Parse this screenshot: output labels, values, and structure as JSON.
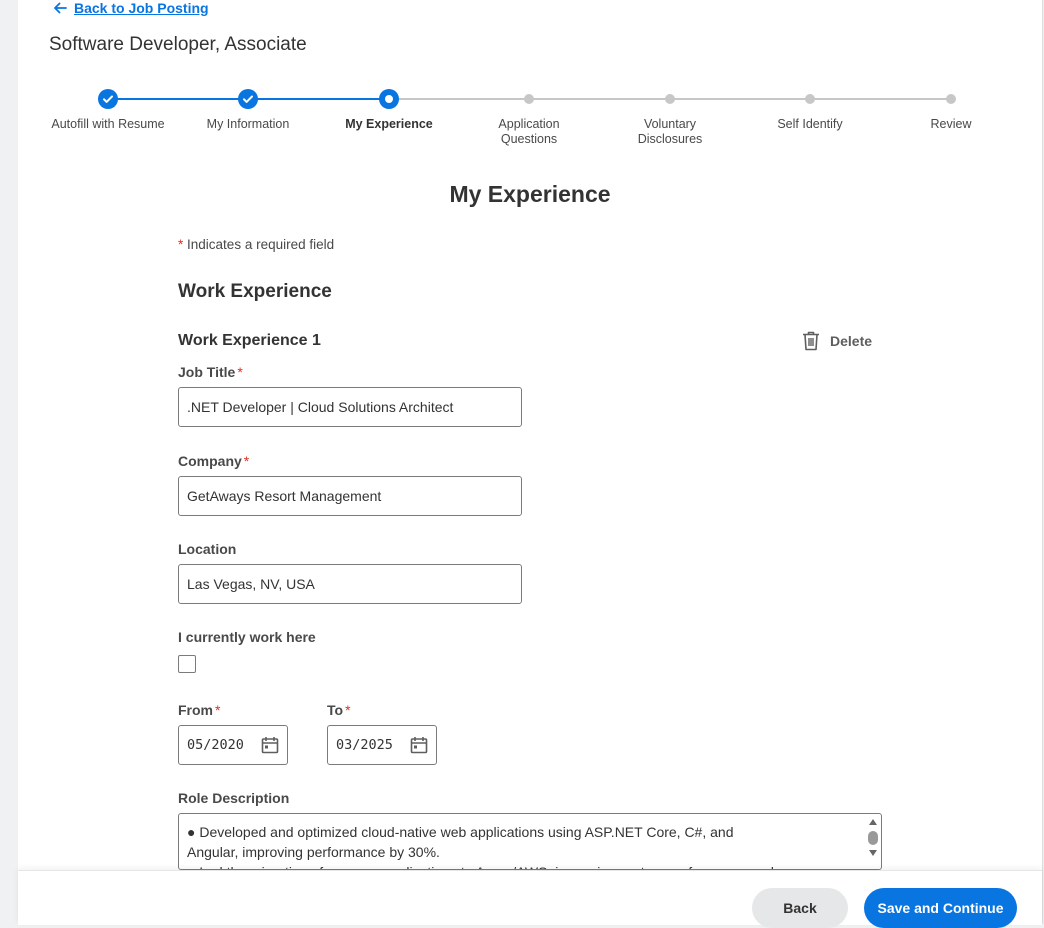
{
  "nav": {
    "back_link": "Back to Job Posting"
  },
  "job": {
    "title": "Software Developer, Associate"
  },
  "stepper": {
    "steps": [
      {
        "label": "Autofill with Resume",
        "status": "done"
      },
      {
        "label": "My Information",
        "status": "done"
      },
      {
        "label": "My Experience",
        "status": "current"
      },
      {
        "label": "Application Questions",
        "status": "todo"
      },
      {
        "label": "Voluntary Disclosures",
        "status": "todo"
      },
      {
        "label": "Self Identify",
        "status": "todo"
      },
      {
        "label": "Review",
        "status": "todo"
      }
    ]
  },
  "page": {
    "heading": "My Experience",
    "required_asterisk": "*",
    "required_note": "Indicates a required field"
  },
  "work_experience": {
    "heading": "Work Experience",
    "entry_heading": "Work Experience 1",
    "delete_label": "Delete",
    "job_title": {
      "label": "Job Title",
      "value": ".NET Developer | Cloud Solutions Architect"
    },
    "company": {
      "label": "Company",
      "value": "GetAways Resort Management"
    },
    "location": {
      "label": "Location",
      "value": "Las Vegas, NV, USA"
    },
    "current": {
      "label": "I currently work here",
      "checked": false
    },
    "from": {
      "label": "From",
      "value": "05/2020"
    },
    "to": {
      "label": "To",
      "value": "03/2025"
    },
    "role_description": {
      "label": "Role Description",
      "lines": [
        "● Developed and optimized cloud-native web applications using ASP.NET Core, C#, and",
        "Angular, improving performance by 30%.",
        "● Led the migration of on-prem applications to Azure/AWS, improving system performance and"
      ]
    }
  },
  "footer": {
    "back_label": "Back",
    "save_label": "Save and Continue"
  },
  "colors": {
    "accent": "#0875e1",
    "required": "#de2e21",
    "inactive": "#c7c7c7"
  }
}
